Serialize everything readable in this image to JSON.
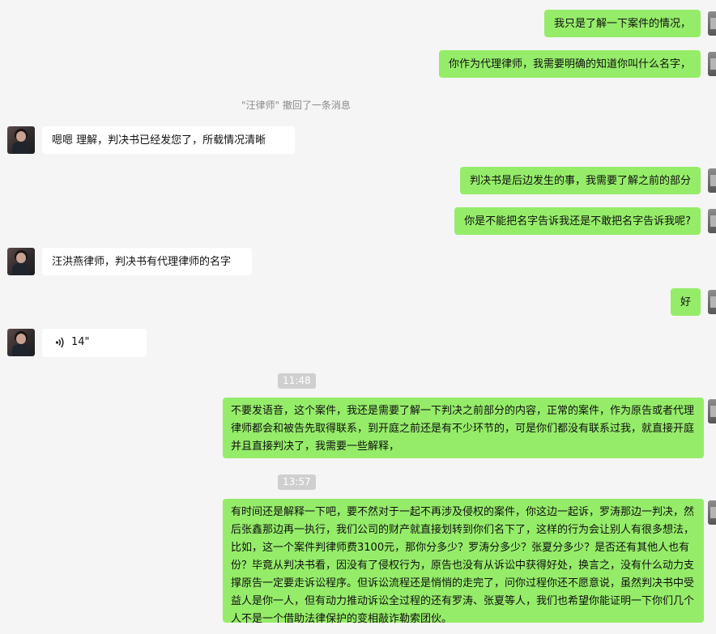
{
  "chat": {
    "sys_recall": "\"汪律师\" 撤回了一条消息",
    "times": [
      "11:48",
      "13:57"
    ],
    "messages": [
      {
        "from": "me",
        "text": "我只是了解一下案件的情况，"
      },
      {
        "from": "me",
        "text": "你作为代理律师，我需要明确的知道你叫什么名字，"
      },
      {
        "from": "them",
        "text": "嗯嗯 理解，判决书已经发您了，所载情况清晰"
      },
      {
        "from": "me",
        "text": "判决书是后边发生的事，我需要了解之前的部分"
      },
      {
        "from": "me",
        "text": "你是不能把名字告诉我还是不敢把名字告诉我呢?"
      },
      {
        "from": "them",
        "text": "汪洪燕律师，判决书有代理律师的名字"
      },
      {
        "from": "me",
        "text": "好"
      },
      {
        "from": "them",
        "type": "voice",
        "duration": "14\""
      },
      {
        "from": "me",
        "text": "不要发语音，这个案件，我还是需要了解一下判决之前部分的内容，正常的案件，作为原告或者代理律师都会和被告先取得联系，到开庭之前还是有不少环节的，可是你们都没有联系过我，就直接开庭并且直接判决了，我需要一些解释，"
      },
      {
        "from": "me",
        "text": "有时间还是解释一下吧，要不然对于一起不再涉及侵权的案件，你这边一起诉，罗涛那边一判决，然后张鑫那边再一执行，我们公司的财产就直接划转到你们名下了，这样的行为会让别人有很多想法，比如，这一个案件判律师费3100元，那你分多少？罗涛分多少？张夏分多少？是否还有其他人也有份？毕竟从判决书看，因没有了侵权行为，原告也没有从诉讼中获得好处，换言之，没有什么动力支撑原告一定要走诉讼程序。但诉讼流程还是悄悄的走完了，问你过程你还不愿意说，虽然判决书中受益人是你一人，但有动力推动诉讼全过程的还有罗涛、张夏等人，我们也希望你能证明一下你们几个人不是一个借助法律保护的变相敲诈勒索团伙。"
      }
    ]
  }
}
